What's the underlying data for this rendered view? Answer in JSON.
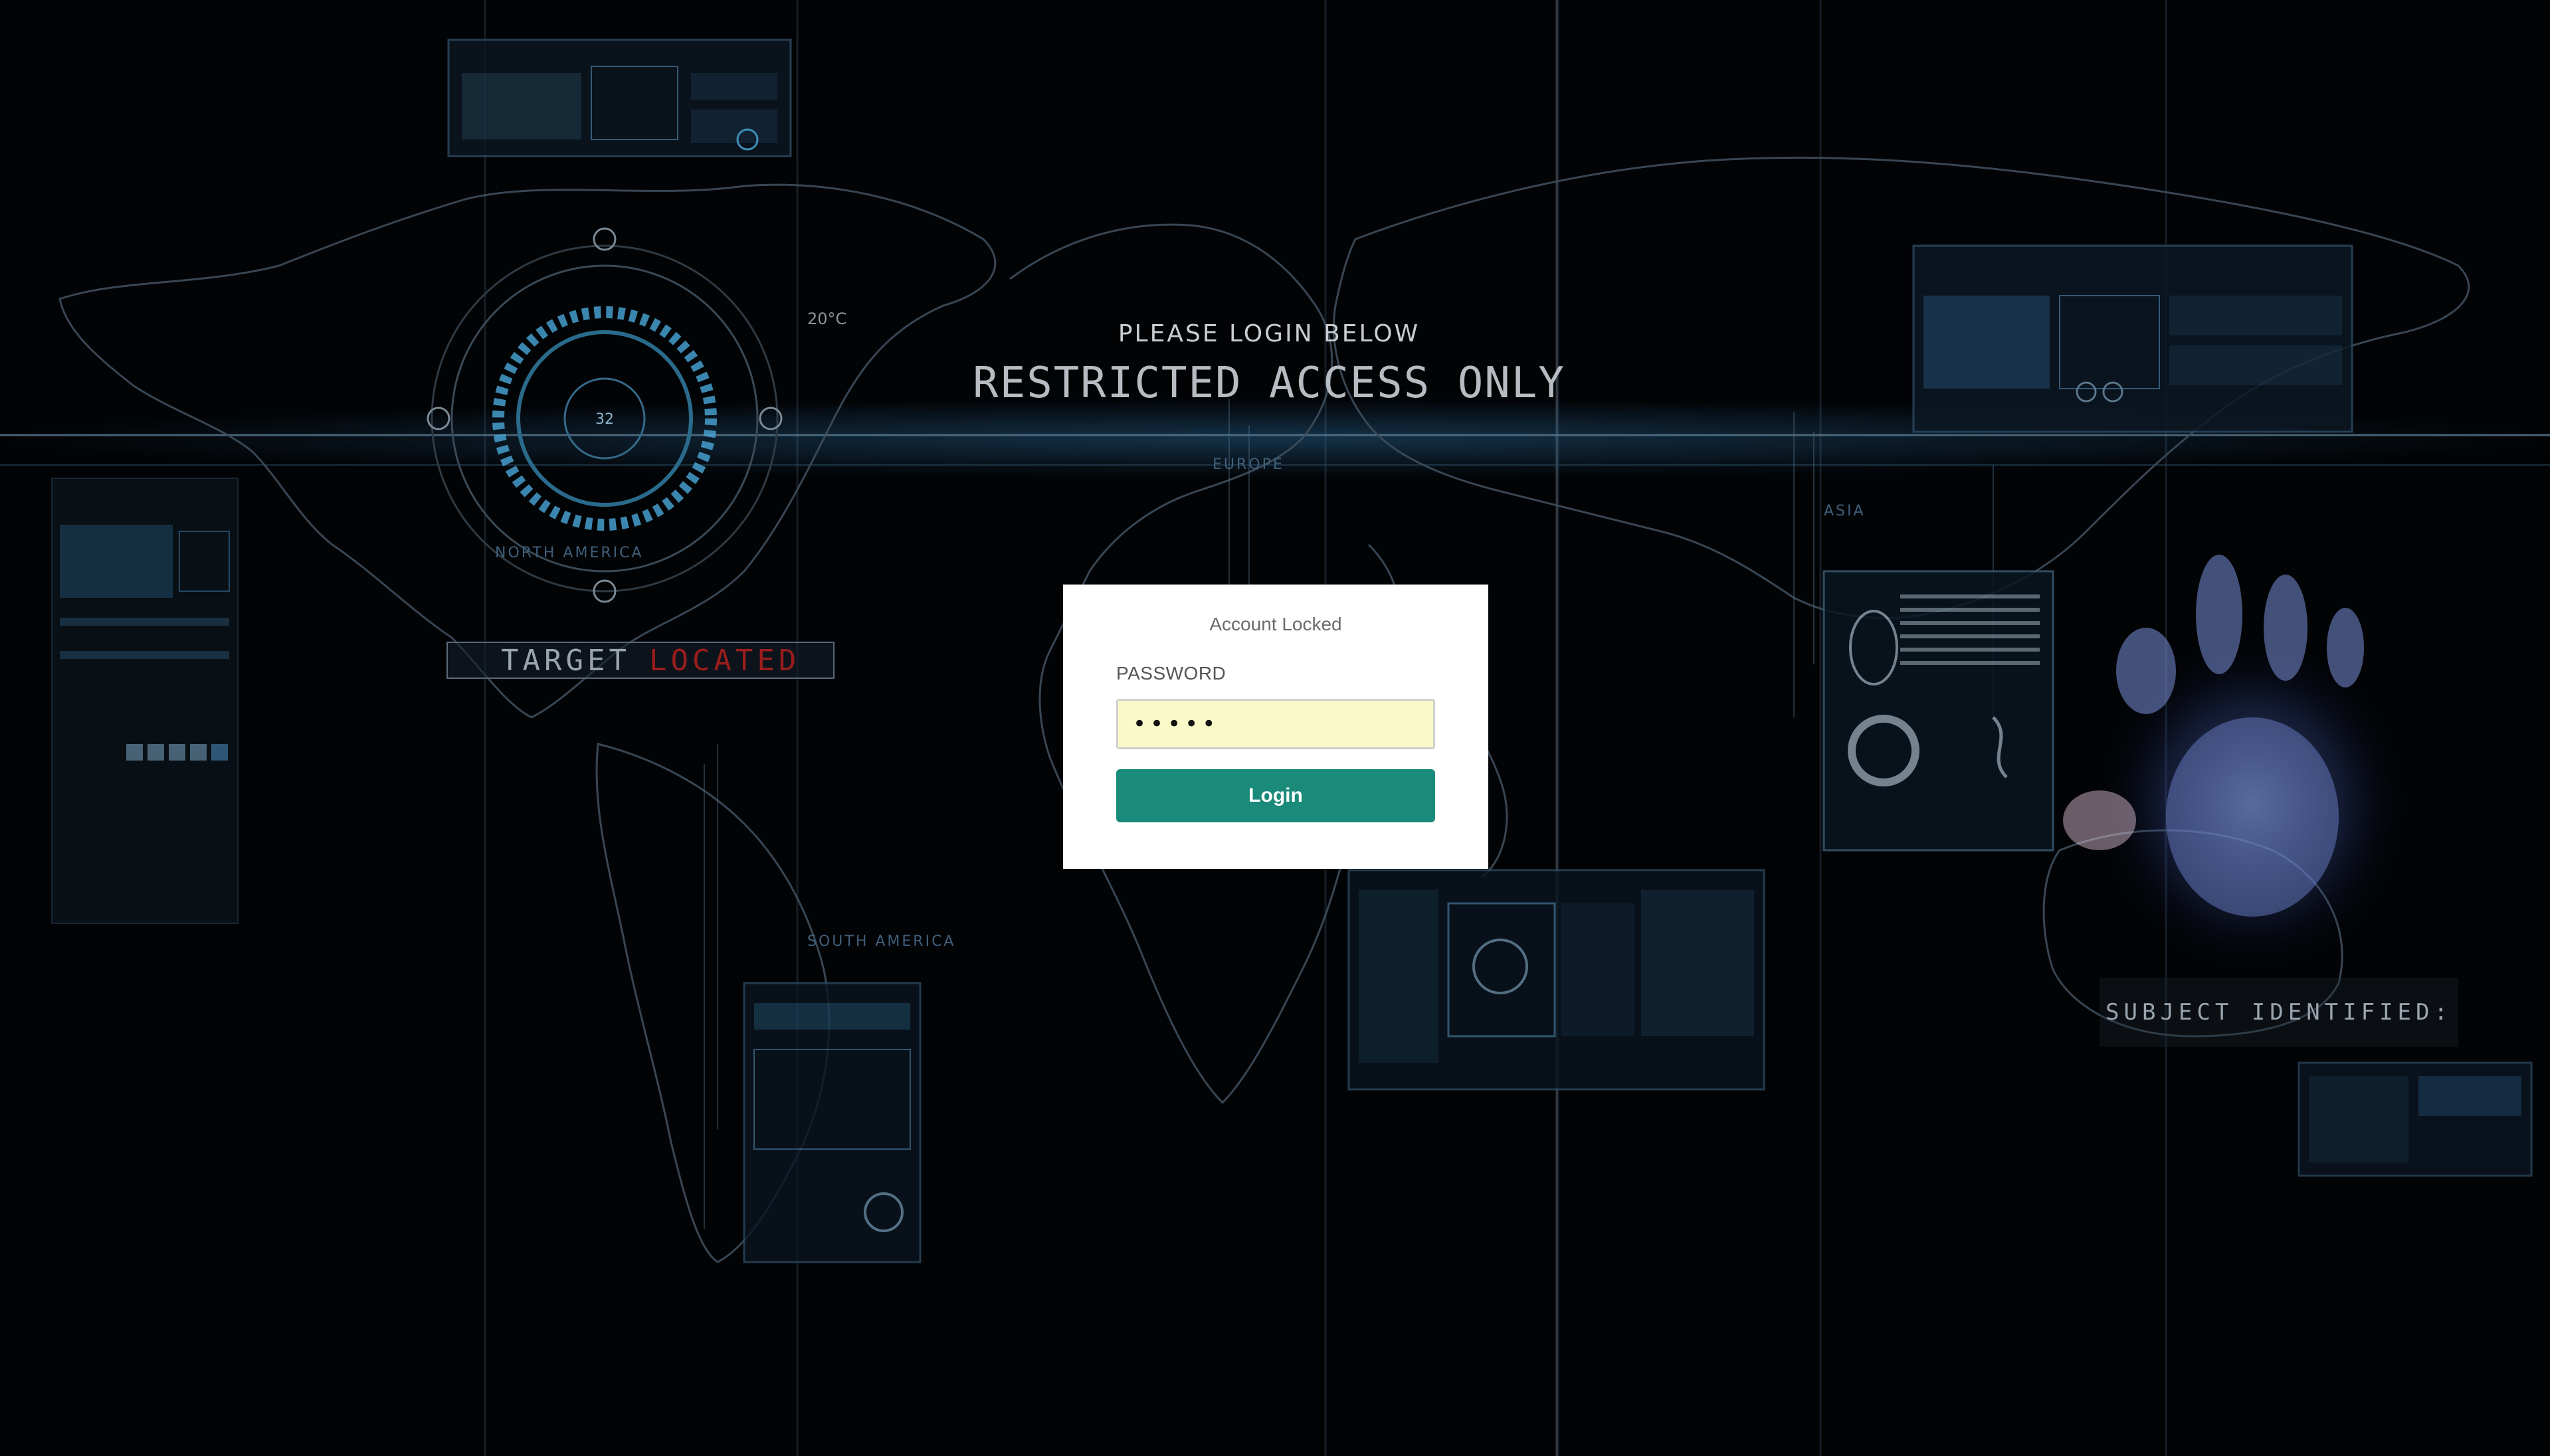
{
  "background": {
    "heading_small": "PLEASE LOGIN BELOW",
    "heading_large": "RESTRICTED ACCESS ONLY",
    "target_word1": "TARGET",
    "target_word2": "LOCATED",
    "subject_text": "SUBJECT IDENTIFIED:",
    "region_labels": [
      "NORTH AMERICA",
      "EUROPE",
      "ASIA",
      "SOUTH AMERICA"
    ],
    "gauge_value": "32",
    "temperature": "20°C"
  },
  "login": {
    "title": "Account Locked",
    "password_label": "PASSWORD",
    "password_value": "•••••",
    "button_label": "Login"
  },
  "colors": {
    "background": "#020305",
    "panel": "#ffffff",
    "button": "#1a8a7a",
    "input_fill": "#fafac8",
    "hud_blue": "#4aa8d8",
    "alert_red": "#9a1d1d"
  }
}
